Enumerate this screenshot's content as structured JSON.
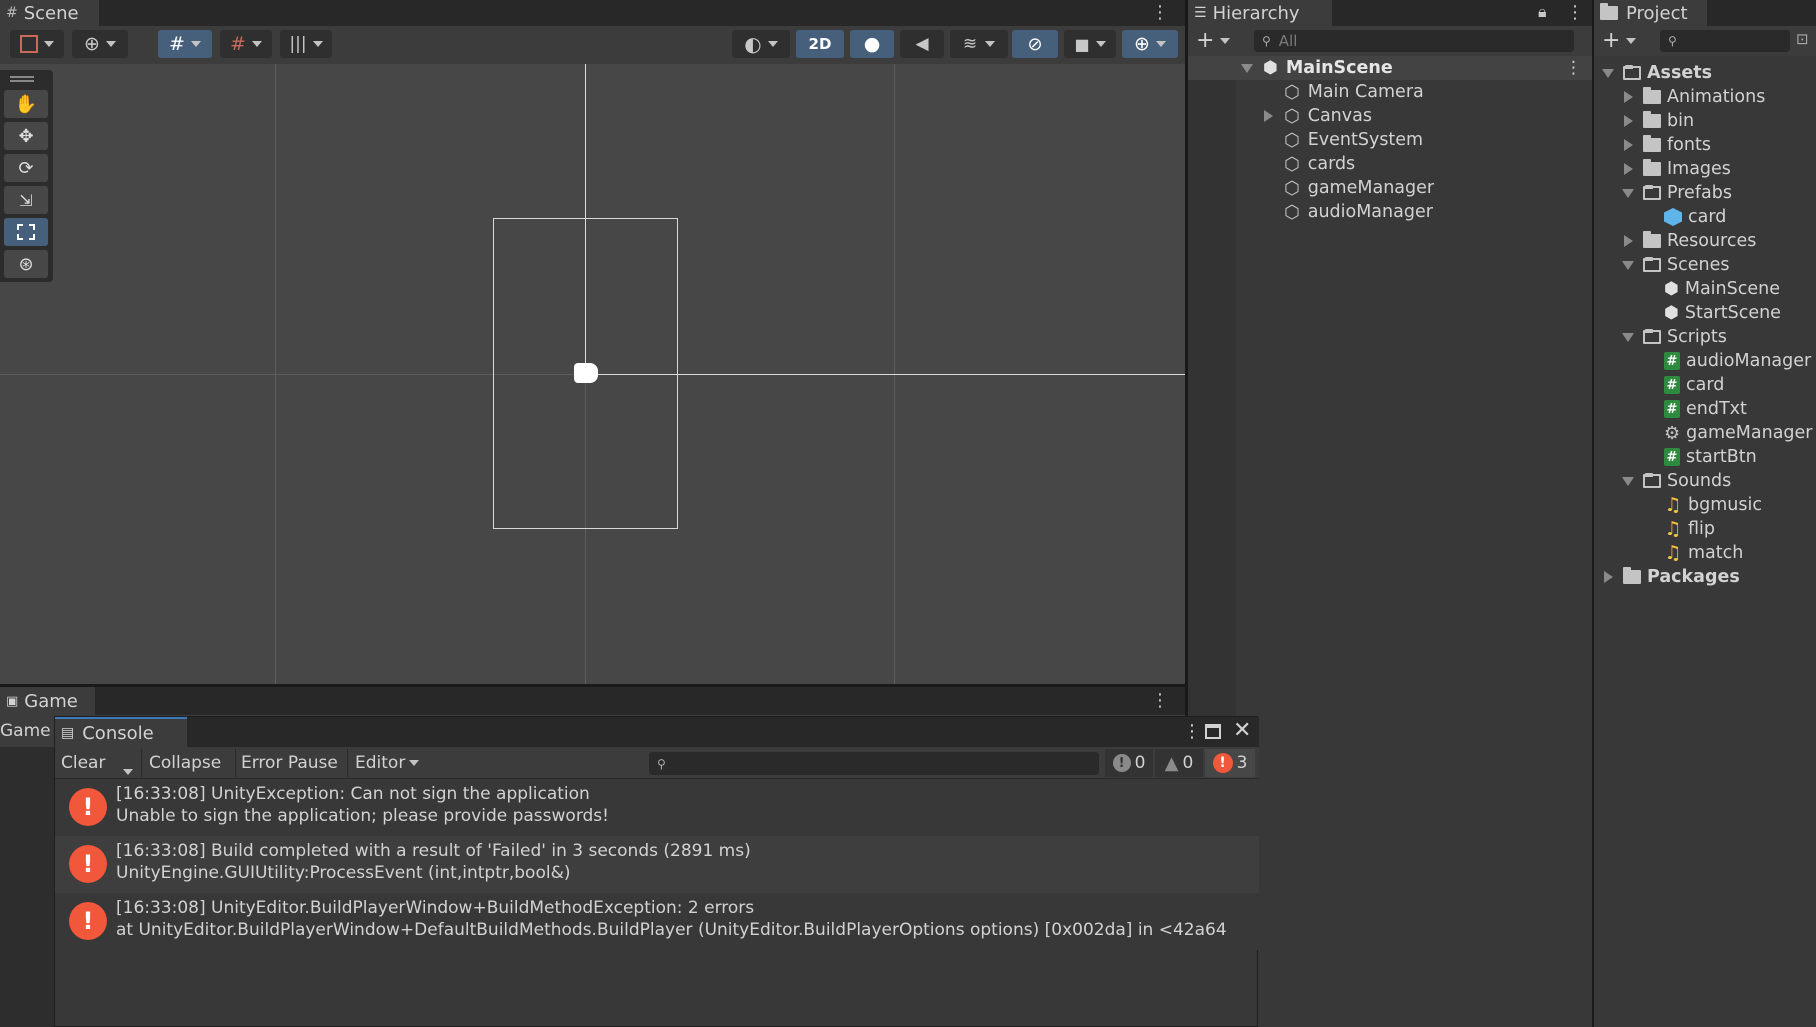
{
  "scene": {
    "tab_label": "Scene",
    "btn_2d": "2D"
  },
  "hierarchy": {
    "tab_label": "Hierarchy",
    "search_placeholder": "All",
    "scene_name": "MainScene",
    "items": [
      {
        "label": "Main Camera",
        "expandable": false
      },
      {
        "label": "Canvas",
        "expandable": true
      },
      {
        "label": "EventSystem",
        "expandable": false
      },
      {
        "label": "cards",
        "expandable": false
      },
      {
        "label": "gameManager",
        "expandable": false
      },
      {
        "label": "audioManager",
        "expandable": false
      }
    ]
  },
  "project": {
    "tab_label": "Project",
    "tree": [
      {
        "label": "Assets",
        "depth": 0,
        "state": "open",
        "type": "folder",
        "bold": true
      },
      {
        "label": "Animations",
        "depth": 1,
        "state": "closed",
        "type": "folder"
      },
      {
        "label": "bin",
        "depth": 1,
        "state": "closed",
        "type": "folder"
      },
      {
        "label": "fonts",
        "depth": 1,
        "state": "closed",
        "type": "folder"
      },
      {
        "label": "Images",
        "depth": 1,
        "state": "closed",
        "type": "folder"
      },
      {
        "label": "Prefabs",
        "depth": 1,
        "state": "open",
        "type": "folder"
      },
      {
        "label": "card",
        "depth": 2,
        "state": "none",
        "type": "prefab"
      },
      {
        "label": "Resources",
        "depth": 1,
        "state": "closed",
        "type": "folder"
      },
      {
        "label": "Scenes",
        "depth": 1,
        "state": "open",
        "type": "folder"
      },
      {
        "label": "MainScene",
        "depth": 2,
        "state": "none",
        "type": "scene"
      },
      {
        "label": "StartScene",
        "depth": 2,
        "state": "none",
        "type": "scene"
      },
      {
        "label": "Scripts",
        "depth": 1,
        "state": "open",
        "type": "folder"
      },
      {
        "label": "audioManager",
        "depth": 2,
        "state": "none",
        "type": "script"
      },
      {
        "label": "card",
        "depth": 2,
        "state": "none",
        "type": "script"
      },
      {
        "label": "endTxt",
        "depth": 2,
        "state": "none",
        "type": "script"
      },
      {
        "label": "gameManager",
        "depth": 2,
        "state": "none",
        "type": "gear"
      },
      {
        "label": "startBtn",
        "depth": 2,
        "state": "none",
        "type": "script"
      },
      {
        "label": "Sounds",
        "depth": 1,
        "state": "open",
        "type": "folder"
      },
      {
        "label": "bgmusic",
        "depth": 2,
        "state": "none",
        "type": "audio"
      },
      {
        "label": "flip",
        "depth": 2,
        "state": "none",
        "type": "audio"
      },
      {
        "label": "match",
        "depth": 2,
        "state": "none",
        "type": "audio"
      },
      {
        "label": "Packages",
        "depth": 0,
        "state": "closed",
        "type": "folder",
        "bold": true
      }
    ]
  },
  "game": {
    "tab_label": "Game",
    "sub_label": "Game"
  },
  "console": {
    "tab_label": "Console",
    "toolbar": {
      "clear": "Clear",
      "collapse": "Collapse",
      "error_pause": "Error Pause",
      "editor": "Editor"
    },
    "counts": {
      "info": "0",
      "warning": "0",
      "error": "3"
    },
    "entries": [
      {
        "line1": "[16:33:08] UnityException: Can not sign the application",
        "line2": "Unable to sign the application; please provide passwords!"
      },
      {
        "line1": "[16:33:08] Build completed with a result of 'Failed' in 3 seconds (2891 ms)",
        "line2": "UnityEngine.GUIUtility:ProcessEvent (int,intptr,bool&)"
      },
      {
        "line1": "[16:33:08] UnityEditor.BuildPlayerWindow+BuildMethodException: 2 errors",
        "line2": "  at UnityEditor.BuildPlayerWindow+DefaultBuildMethods.BuildPlayer (UnityEditor.BuildPlayerOptions options) [0x002da] in <42a64"
      }
    ]
  },
  "colors": {
    "accent": "#46607c",
    "error": "#f0573b",
    "panel": "#383838",
    "scene_bg": "#474747"
  }
}
